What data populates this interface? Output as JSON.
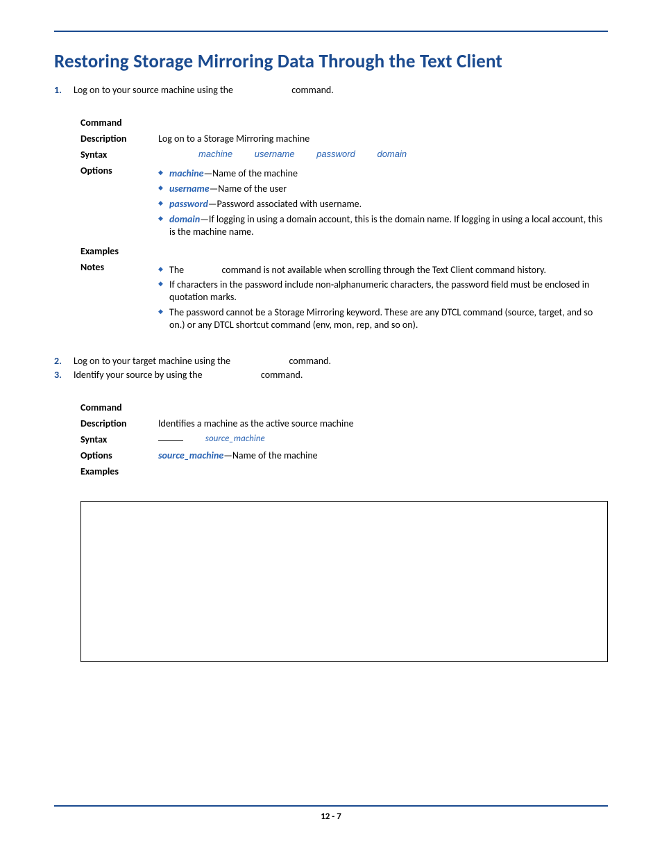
{
  "title": "Restoring Storage Mirroring Data Through the Text Client",
  "steps": {
    "s1": {
      "num": "1.",
      "pre": "Log on to your source machine using the ",
      "post": " command."
    },
    "s2": {
      "num": "2.",
      "pre": "Log on to your target machine using the ",
      "post": " command."
    },
    "s3": {
      "num": "3.",
      "pre": "Identify your source by using the ",
      "post": " command."
    }
  },
  "labels": {
    "command": "Command",
    "description": "Description",
    "syntax": "Syntax",
    "options": "Options",
    "examples": "Examples",
    "notes": "Notes"
  },
  "login_block": {
    "description": "Log on to a Storage Mirroring machine",
    "syntax_params": {
      "p1": "machine",
      "p2": "username",
      "p3": "password",
      "p4": "domain"
    },
    "options": {
      "machine": {
        "name": "machine",
        "desc": "—Name of the machine"
      },
      "username": {
        "name": "username",
        "desc": "—Name of the user"
      },
      "password": {
        "name": "password",
        "desc": "—Password associated with username."
      },
      "domain": {
        "name": "domain",
        "desc": "—If logging in using a domain account, this is the domain name. If logging in using a local account, this is the machine name."
      }
    },
    "notes": {
      "n1a": "The ",
      "n1b": " command is not available when scrolling through the Text Client command history.",
      "n2": "If characters in the password include non-alphanumeric characters, the password field must be enclosed in quotation marks.",
      "n3": "The password cannot be a Storage Mirroring keyword. These are any DTCL command (source, target, and so on.) or any DTCL shortcut command (env, mon, rep, and so on)."
    }
  },
  "source_block": {
    "description": "Identifies a machine as the active source machine",
    "syntax_param": "source_machine",
    "option_name": "source_machine",
    "option_desc": "—Name of the machine"
  },
  "page_number": "12 - 7"
}
